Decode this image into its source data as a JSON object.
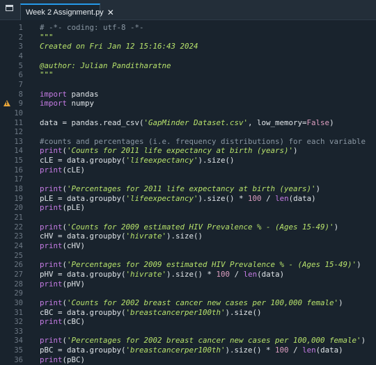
{
  "tab": {
    "label": "Week 2 Assignment.py",
    "close": "✕"
  },
  "editor": {
    "lines": [
      {
        "n": "1",
        "code": "<span class='cm'># -*- coding: utf-8 -*-</span>"
      },
      {
        "n": "2",
        "code": "<span class='st'>\"\"\"</span>"
      },
      {
        "n": "3",
        "code": "<span class='st'>Created on Fri Jan 12 15:16:43 2024</span>"
      },
      {
        "n": "4",
        "code": ""
      },
      {
        "n": "5",
        "code": "<span class='st'>@author: Julian Panditharatne</span>"
      },
      {
        "n": "6",
        "code": "<span class='st'>\"\"\"</span>"
      },
      {
        "n": "7",
        "code": ""
      },
      {
        "n": "8",
        "code": "<span class='kw'>import</span> pandas"
      },
      {
        "n": "9",
        "code": "<span class='kw'>import</span> numpy",
        "warning": true
      },
      {
        "n": "10",
        "code": ""
      },
      {
        "n": "11",
        "code": "data = pandas.read_csv(<span class='st'>'GapMinder Dataset.csv'</span>, low_memory=<span class='kv'>False</span>)"
      },
      {
        "n": "12",
        "code": ""
      },
      {
        "n": "13",
        "code": "<span class='cm'>#counts and percentages (i.e. frequency distributions) for each variable</span>"
      },
      {
        "n": "14",
        "code": "<span class='bi'>print</span>(<span class='st'>'Counts for 2011 life expectancy at birth (years)'</span>)"
      },
      {
        "n": "15",
        "code": "cLE = data.groupby(<span class='st'>'lifeexpectancy'</span>).size()"
      },
      {
        "n": "16",
        "code": "<span class='bi'>print</span>(cLE)"
      },
      {
        "n": "17",
        "code": ""
      },
      {
        "n": "18",
        "code": "<span class='bi'>print</span>(<span class='st'>'Percentages for 2011 life expectancy at birth (years)'</span>)"
      },
      {
        "n": "19",
        "code": "pLE = data.groupby(<span class='st'>'lifeexpectancy'</span>).size() * <span class='num'>100</span> / <span class='bi'>len</span>(data)"
      },
      {
        "n": "20",
        "code": "<span class='bi'>print</span>(pLE)"
      },
      {
        "n": "21",
        "code": ""
      },
      {
        "n": "22",
        "code": "<span class='bi'>print</span>(<span class='st'>'Counts for 2009 estimated HIV Prevalence % - (Ages 15-49)'</span>)"
      },
      {
        "n": "23",
        "code": "cHV = data.groupby(<span class='st'>'hivrate'</span>).size()"
      },
      {
        "n": "24",
        "code": "<span class='bi'>print</span>(cHV)"
      },
      {
        "n": "25",
        "code": ""
      },
      {
        "n": "26",
        "code": "<span class='bi'>print</span>(<span class='st'>'Percentages for 2009 estimated HIV Prevalence % - (Ages 15-49)'</span>)"
      },
      {
        "n": "27",
        "code": "pHV = data.groupby(<span class='st'>'hivrate'</span>).size() * <span class='num'>100</span> / <span class='bi'>len</span>(data)"
      },
      {
        "n": "28",
        "code": "<span class='bi'>print</span>(pHV)"
      },
      {
        "n": "29",
        "code": ""
      },
      {
        "n": "30",
        "code": "<span class='bi'>print</span>(<span class='st'>'Counts for 2002 breast cancer new cases per 100,000 female'</span>)"
      },
      {
        "n": "31",
        "code": "cBC = data.groupby(<span class='st'>'breastcancerper100th'</span>).size()"
      },
      {
        "n": "32",
        "code": "<span class='bi'>print</span>(cBC)"
      },
      {
        "n": "33",
        "code": ""
      },
      {
        "n": "34",
        "code": "<span class='bi'>print</span>(<span class='st'>'Percentages for 2002 breast cancer new cases per 100,000 female'</span>)"
      },
      {
        "n": "35",
        "code": "pBC = data.groupby(<span class='st'>'breastcancerper100th'</span>).size() * <span class='num'>100</span> / <span class='bi'>len</span>(data)"
      },
      {
        "n": "36",
        "code": "<span class='bi'>print</span>(pBC)"
      }
    ]
  }
}
